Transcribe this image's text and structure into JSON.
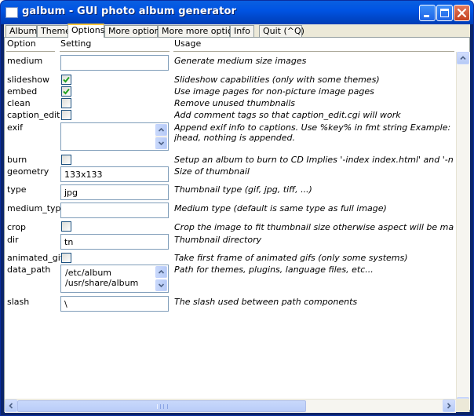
{
  "window": {
    "title": "galbum - GUI photo album generator"
  },
  "tabs": [
    {
      "label": "Album"
    },
    {
      "label": "Theme"
    },
    {
      "label": "Options"
    },
    {
      "label": "More options"
    },
    {
      "label": "More more options"
    },
    {
      "label": "Info"
    },
    {
      "label": "Quit (^Q)"
    }
  ],
  "active_tab": "Options",
  "columns": {
    "option": "Option",
    "setting": "Setting",
    "usage": "Usage"
  },
  "rows": {
    "medium": {
      "label": "medium",
      "value": "",
      "usage": "Generate medium size images"
    },
    "slideshow": {
      "label": "slideshow",
      "checked": true,
      "usage": "Slideshow capabilities (only with some themes)"
    },
    "embed": {
      "label": "embed",
      "checked": true,
      "usage": "Use image pages for non-picture image pages"
    },
    "clean": {
      "label": "clean",
      "checked": false,
      "usage": "Remove unused thumbnails"
    },
    "caption_edit": {
      "label": "caption_edit",
      "checked": false,
      "usage": "Add comment tags so that caption_edit.cgi will work"
    },
    "exif": {
      "label": "exif",
      "value": "",
      "usage_line1": "Append exif info to captions.  Use %key% in fmt string  Example:  -exif '<br>Ca",
      "usage_line2": "jhead, nothing is appended."
    },
    "burn": {
      "label": "burn",
      "checked": false,
      "usage": "Setup an album to burn to CD  Implies '-index index.html' and '-no_theme_url'"
    },
    "geometry": {
      "label": "geometry",
      "value": "133x133",
      "usage": "Size of thumbnail"
    },
    "type": {
      "label": "type",
      "value": "jpg",
      "usage": "Thumbnail type (gif, jpg, tiff, ...)"
    },
    "medium_type": {
      "label": "medium_type",
      "value": "",
      "usage": "Medium type (default is same type as full image)"
    },
    "crop": {
      "label": "crop",
      "checked": false,
      "usage": "Crop the image to fit thumbnail size  otherwise aspect will be maintained"
    },
    "dir": {
      "label": "dir",
      "value": "tn",
      "usage": "Thumbnail directory"
    },
    "animated_gifs": {
      "label": "animated_gifs",
      "checked": false,
      "usage": "Take first frame of animated gifs (only some systems)"
    },
    "data_path": {
      "label": "data_path",
      "lines": [
        "/etc/album",
        "/usr/share/album"
      ],
      "usage": "Path for themes, plugins, language files, etc..."
    },
    "slash": {
      "label": "slash",
      "value": "\\",
      "usage": "The slash used between path components"
    }
  },
  "icons": [
    "app-icon",
    "minimize-icon",
    "maximize-icon",
    "close-icon",
    "checkmark-icon",
    "arrow-up-icon",
    "arrow-down-icon",
    "arrow-left-icon",
    "arrow-right-icon"
  ],
  "colors": {
    "titlebar": "#0054e3",
    "active_tab_accent": "#ffc73c",
    "check": "#21a121",
    "field_border": "#7f9db9"
  }
}
